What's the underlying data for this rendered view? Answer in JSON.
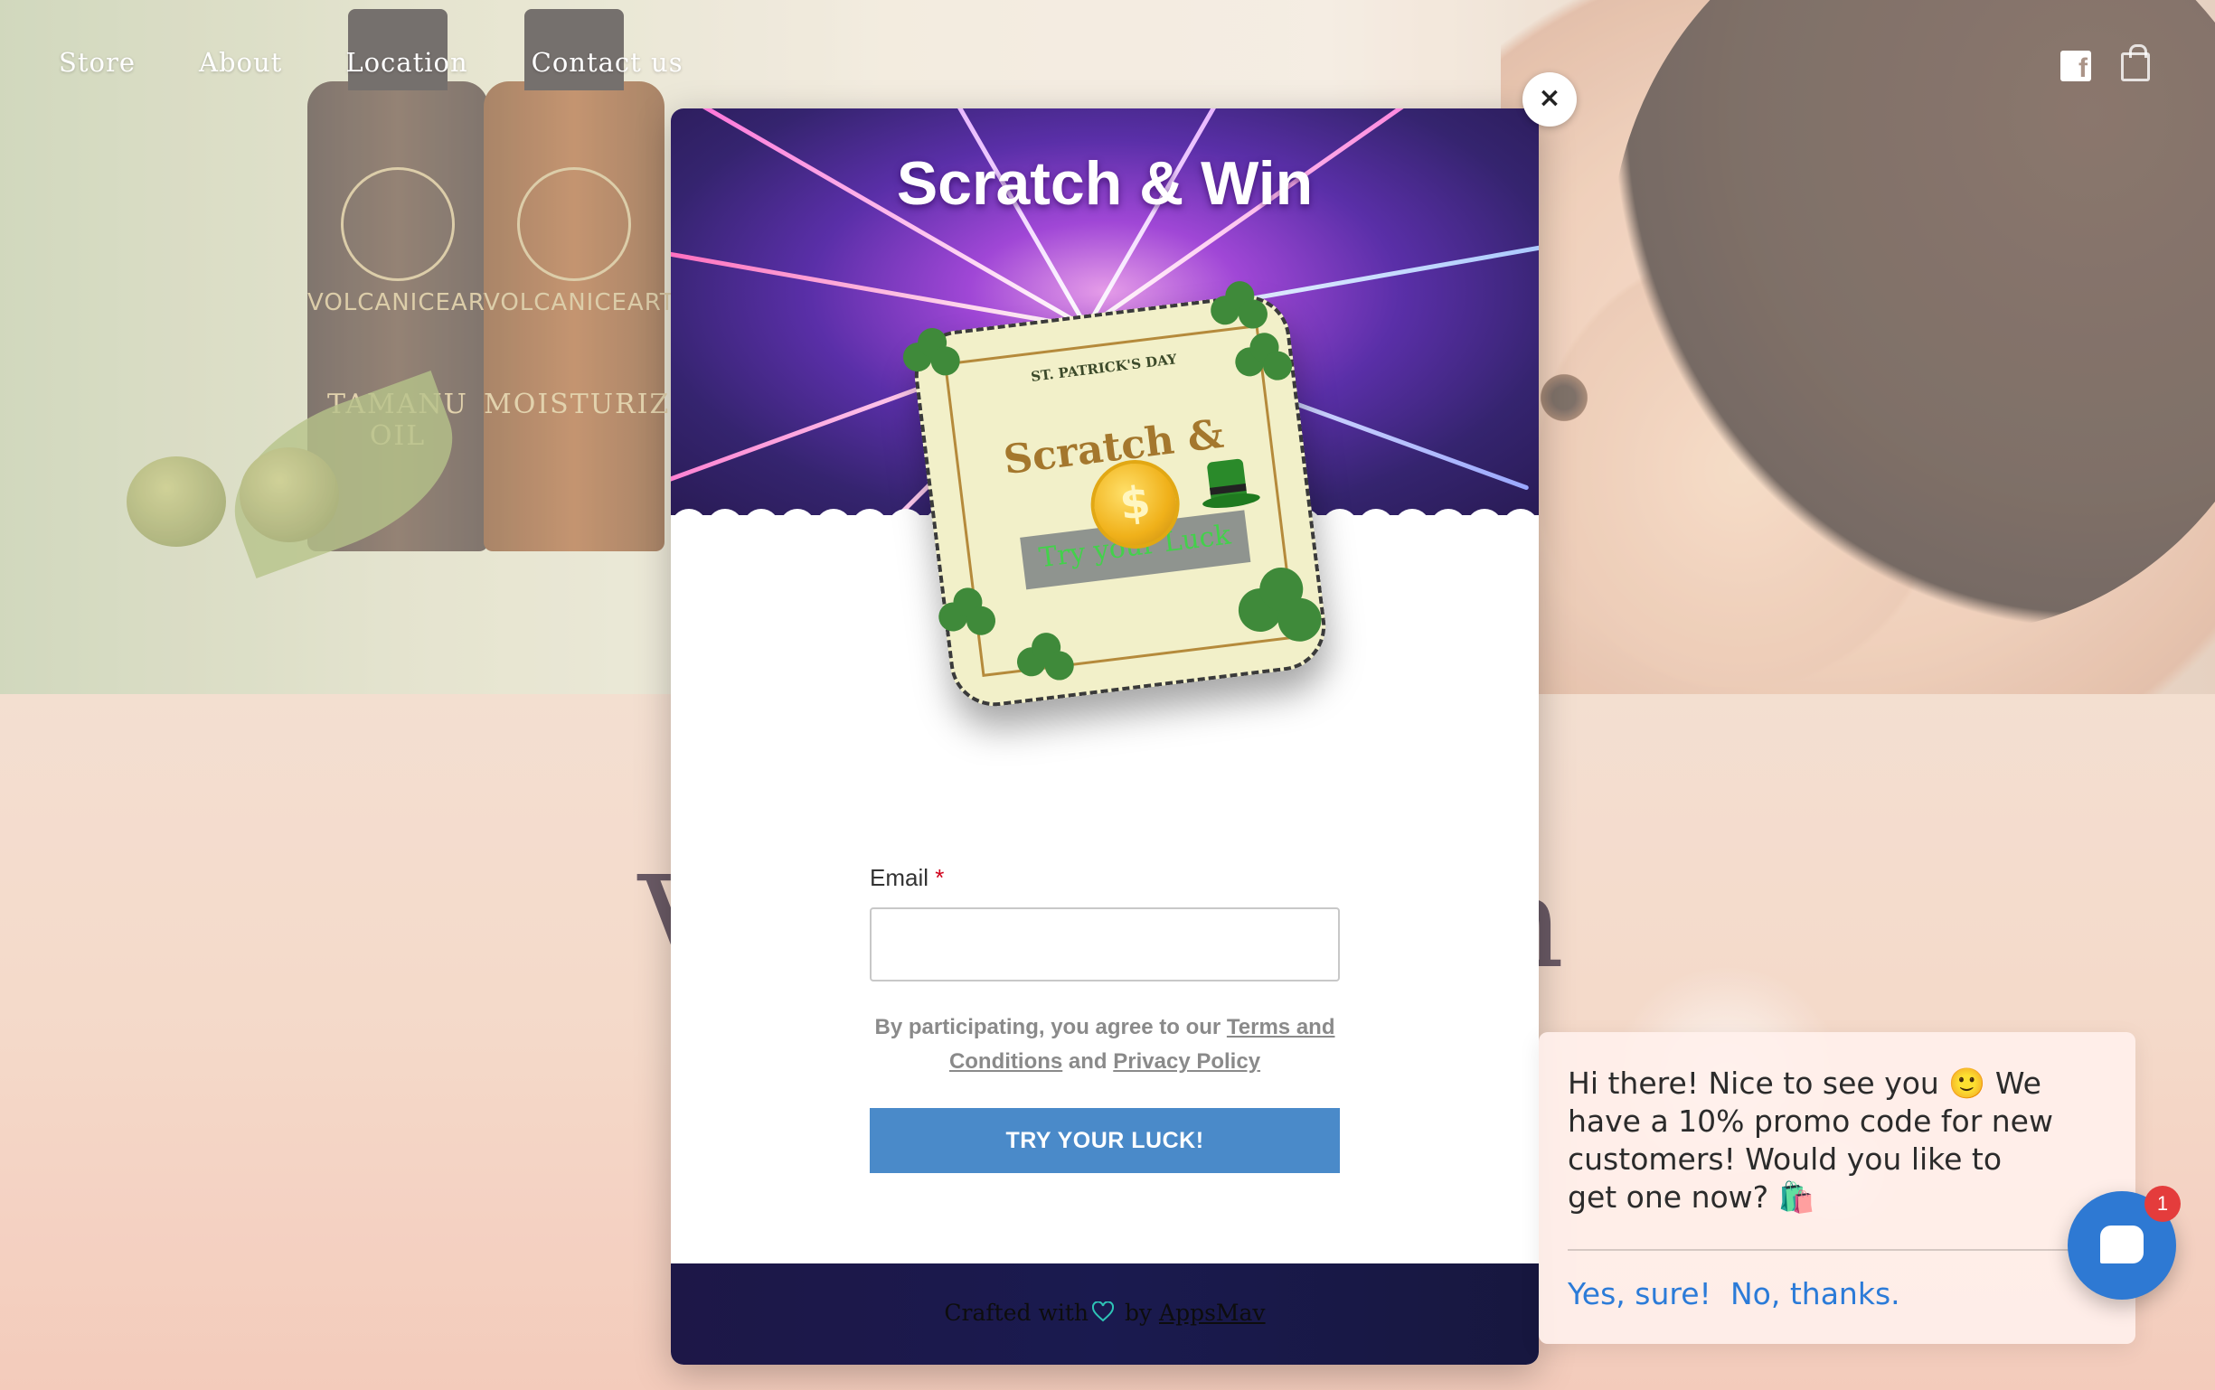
{
  "nav": {
    "items": [
      "Store",
      "About",
      "Location",
      "Contact us"
    ]
  },
  "hero": {
    "bottles": [
      {
        "brand": "VOLCANICEARTH",
        "product": "TAMANU OIL"
      },
      {
        "brand": "VOLCANICEARTH",
        "product": "MOISTURIZER"
      }
    ]
  },
  "popup": {
    "title": "Scratch & Win",
    "close_label": "×",
    "card": {
      "small_text": "ST. PATRICK'S DAY",
      "big_text": "Scratch &",
      "strip_text": "Try your Luck",
      "coin_symbol": "$"
    },
    "email_label": "Email",
    "required_mark": "*",
    "email_value": "",
    "legal_prefix": "By participating, you agree to our ",
    "terms_link": "Terms and Conditions",
    "legal_and": " and ",
    "privacy_link": "Privacy Policy",
    "cta": "TRY YOUR LUCK!",
    "footer_prefix": "Crafted with",
    "footer_by": " by ",
    "footer_link": "AppsMav"
  },
  "chat": {
    "message": "Hi there! Nice to see you 🙂 We have a 10% promo code for new customers! Would you like to get one now? 🛍️",
    "yes_label": "Yes, sure!",
    "no_label": "No, thanks.",
    "badge_count": "1"
  },
  "colors": {
    "cta": "#4a8ac9",
    "chat_accent": "#2e79d3",
    "badge": "#e43c3c"
  }
}
